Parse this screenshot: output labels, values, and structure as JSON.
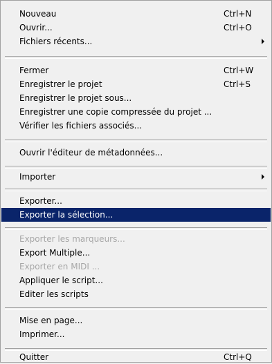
{
  "menu": {
    "colors": {
      "background": "#f0f0f0",
      "highlight": "#0a246a",
      "highlight_text": "#ffffff",
      "disabled_text": "#a7a7a7"
    },
    "items": {
      "nouveau": {
        "label": "Nouveau",
        "shortcut": "Ctrl+N"
      },
      "ouvrir": {
        "label": "Ouvrir...",
        "shortcut": "Ctrl+O"
      },
      "fichiers_recents": {
        "label": "Fichiers récents...",
        "submenu_icon": "submenu-arrow-icon"
      },
      "fermer": {
        "label": "Fermer",
        "shortcut": "Ctrl+W"
      },
      "enregistrer": {
        "label": "Enregistrer le projet",
        "shortcut": "Ctrl+S"
      },
      "enregistrer_sous": {
        "label": "Enregistrer le projet sous..."
      },
      "enregistrer_copie": {
        "label": "Enregistrer une copie compressée du projet ..."
      },
      "verifier": {
        "label": "Vérifier les fichiers associés..."
      },
      "editeur_metadonnees": {
        "label": "Ouvrir l'éditeur de métadonnées..."
      },
      "importer": {
        "label": "Importer",
        "submenu_icon": "submenu-arrow-icon"
      },
      "exporter": {
        "label": "Exporter..."
      },
      "exporter_selection": {
        "label": "Exporter la sélection...",
        "state": "highlighted"
      },
      "exporter_marqueurs": {
        "label": "Exporter les marqueurs...",
        "state": "disabled"
      },
      "export_multiple": {
        "label": "Export Multiple..."
      },
      "exporter_midi": {
        "label": "Exporter en MIDI ...",
        "state": "disabled"
      },
      "appliquer_script": {
        "label": "Appliquer le script..."
      },
      "editer_scripts": {
        "label": "Editer les scripts"
      },
      "mise_en_page": {
        "label": "Mise en page..."
      },
      "imprimer": {
        "label": "Imprimer..."
      },
      "quitter": {
        "label": "Quitter",
        "shortcut": "Ctrl+Q"
      }
    }
  }
}
